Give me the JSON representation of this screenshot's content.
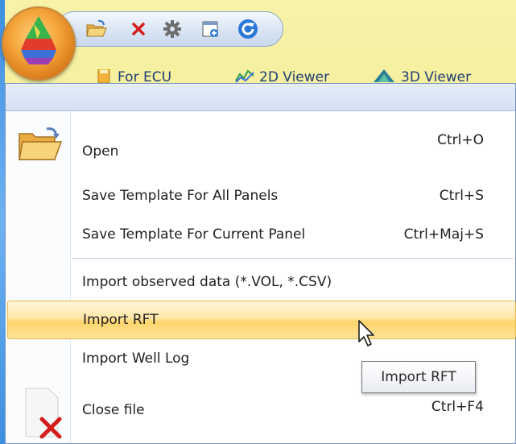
{
  "ribbon": {
    "tabs": [
      {
        "label": "For ECU",
        "icon": "ecu-icon"
      },
      {
        "label": "2D Viewer",
        "icon": "2d-viewer-icon"
      },
      {
        "label": "3D Viewer",
        "icon": "3d-viewer-icon"
      }
    ]
  },
  "quick_access": {
    "buttons": [
      "open-icon",
      "close-icon",
      "gear-icon",
      "new-panel-icon",
      "refresh-icon"
    ]
  },
  "menu": {
    "items": [
      {
        "label": "Open",
        "shortcut": "Ctrl+O",
        "icon": "folder-open-icon"
      },
      {
        "label": "Save Template For All Panels",
        "shortcut": "Ctrl+S"
      },
      {
        "label": "Save Template For Current Panel",
        "shortcut": "Ctrl+Maj+S"
      },
      {
        "label": "Import observed data (*.VOL, *.CSV)",
        "shortcut": ""
      },
      {
        "label": "Import RFT",
        "shortcut": "",
        "highlighted": true
      },
      {
        "label": "Import Well Log",
        "shortcut": ""
      },
      {
        "label": "Close file",
        "shortcut": "Ctrl+F4",
        "icon": "close-file-icon"
      }
    ]
  },
  "tooltip": {
    "text": "Import RFT"
  },
  "colors": {
    "highlight": "#ffd46b",
    "accent_blue": "#3d8fe0",
    "orb": "#f4a43a"
  }
}
